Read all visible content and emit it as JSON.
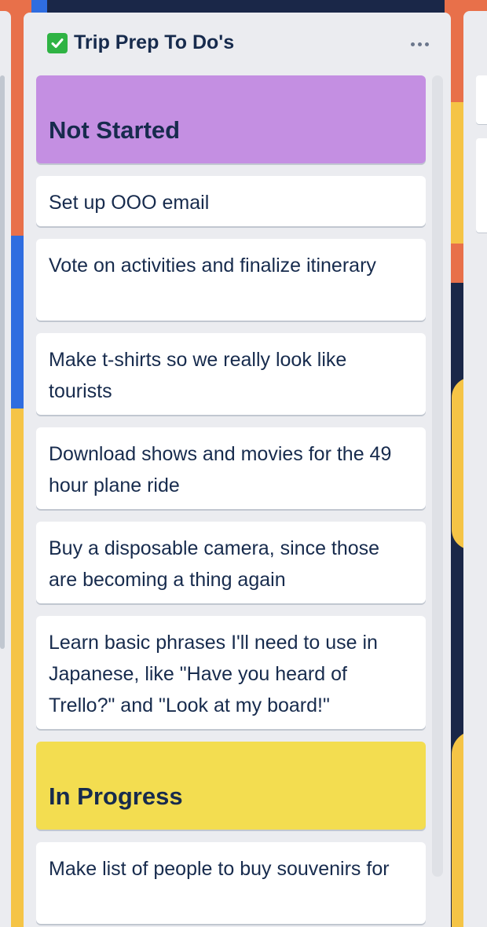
{
  "list": {
    "title": "Trip Prep To Do's",
    "title_icon": "white-check-mark-emoji",
    "menu_icon": "ellipsis-icon",
    "cards": [
      {
        "text": "Not Started",
        "type": "heading",
        "color": "#c48fe2"
      },
      {
        "text": "Set up OOO email",
        "type": "card"
      },
      {
        "text": "Vote on activities and finalize itinerary",
        "type": "card"
      },
      {
        "text": "Make t-shirts so we really look like tourists",
        "type": "card"
      },
      {
        "text": "Download shows and movies for the 49 hour plane ride",
        "type": "card"
      },
      {
        "text": "Buy a disposable camera, since those are becoming a thing again",
        "type": "card"
      },
      {
        "text": "Learn basic phrases I'll need to use in Japanese, like \"Have you heard of Trello?\" and \"Look at my board!\"",
        "type": "card"
      },
      {
        "text": "In Progress",
        "type": "heading",
        "color": "#f3dd50"
      },
      {
        "text": "Make list of people to buy souvenirs for",
        "type": "card"
      }
    ]
  },
  "colors": {
    "list_bg": "#ebecf0",
    "text": "#172b4d",
    "check_green": "#2fb344"
  }
}
